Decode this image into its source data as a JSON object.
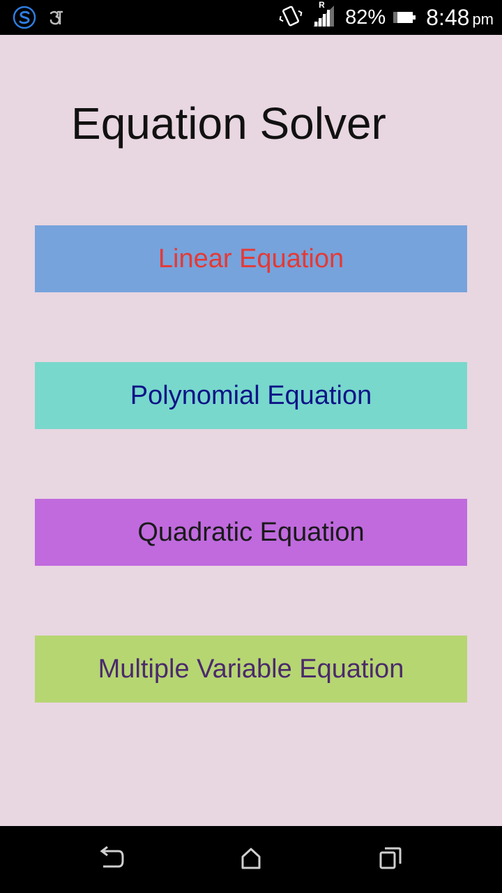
{
  "status_bar": {
    "network_type": "R",
    "battery_percent": "82%",
    "time": "8:48",
    "ampm": "pm",
    "icons": [
      "skype-icon",
      "notification-app-icon",
      "vibrate-icon",
      "signal-icon",
      "battery-icon"
    ]
  },
  "app": {
    "title": "Equation Solver",
    "background": "#e8d6e1"
  },
  "buttons": [
    {
      "label": "Linear Equation",
      "bg": "#76a3dc",
      "color": "#e53935"
    },
    {
      "label": "Polynomial Equation",
      "bg": "#78d8cc",
      "color": "#0d1487"
    },
    {
      "label": "Quadratic Equation",
      "bg": "#c06ade",
      "color": "#1a1a1a"
    },
    {
      "label": "Multiple Variable Equation",
      "bg": "#b6d672",
      "color": "#4b2a6b"
    }
  ],
  "nav_bar": {
    "icons": [
      "back-icon",
      "home-icon",
      "recent-apps-icon"
    ]
  }
}
